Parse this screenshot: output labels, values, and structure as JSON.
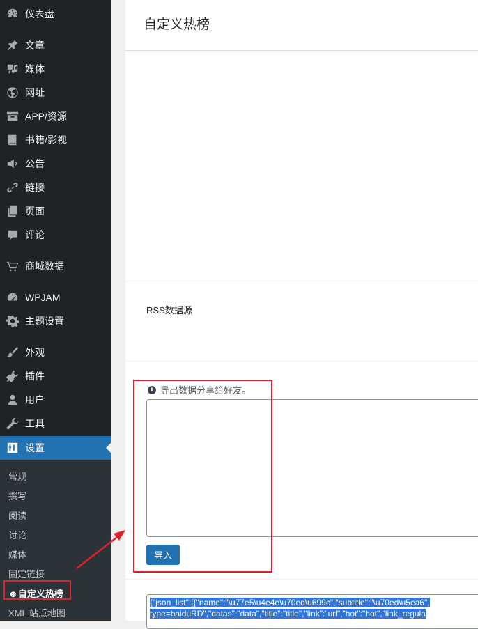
{
  "sidebar": {
    "menu": [
      {
        "label": "仪表盘",
        "icon": "dashboard-icon"
      },
      {
        "label": "文章",
        "icon": "pushpin-icon"
      },
      {
        "label": "媒体",
        "icon": "media-icon"
      },
      {
        "label": "网址",
        "icon": "globe-icon"
      },
      {
        "label": "APP/资源",
        "icon": "archive-icon"
      },
      {
        "label": "书籍/影视",
        "icon": "book-icon"
      },
      {
        "label": "公告",
        "icon": "megaphone-icon"
      },
      {
        "label": "链接",
        "icon": "link-icon"
      },
      {
        "label": "页面",
        "icon": "page-icon"
      },
      {
        "label": "评论",
        "icon": "comment-icon"
      },
      {
        "label": "商城数据",
        "icon": "cart-icon"
      },
      {
        "label": "WPJAM",
        "icon": "gauge-icon"
      },
      {
        "label": "主题设置",
        "icon": "gear-icon"
      },
      {
        "label": "外观",
        "icon": "brush-icon"
      },
      {
        "label": "插件",
        "icon": "plugin-icon"
      },
      {
        "label": "用户",
        "icon": "user-icon"
      },
      {
        "label": "工具",
        "icon": "wrench-icon"
      },
      {
        "label": "设置",
        "icon": "settings-sliders-icon"
      }
    ],
    "submenu": [
      "常规",
      "撰写",
      "阅读",
      "讨论",
      "媒体",
      "固定链接",
      "自定义热榜",
      "XML 站点地图"
    ],
    "current_submenu_prefix": "☻"
  },
  "header": {
    "title": "自定义热榜"
  },
  "main": {
    "rss_label": "RSS数据源",
    "export_description": "导出数据分享给好友。",
    "info_icon_glyph": "i",
    "import_button": "导入",
    "import_value": "",
    "json_export_line1": "{\"json_list\":[{\"name\":\"\\u77e5\\u4e4e\\u70ed\\u699c\",\"subtitle\":\"\\u70ed\\u5ea6\",",
    "json_export_line2": "type=baiduRD\",\"datas\":\"data\",\"title\":\"title\",\"link\":\"url\",\"hot\":\"hot\",\"link_regula"
  },
  "colors": {
    "sidebar_bg": "#1d2327",
    "active_blue": "#2271b1",
    "annotation_red": "#e0202a"
  }
}
